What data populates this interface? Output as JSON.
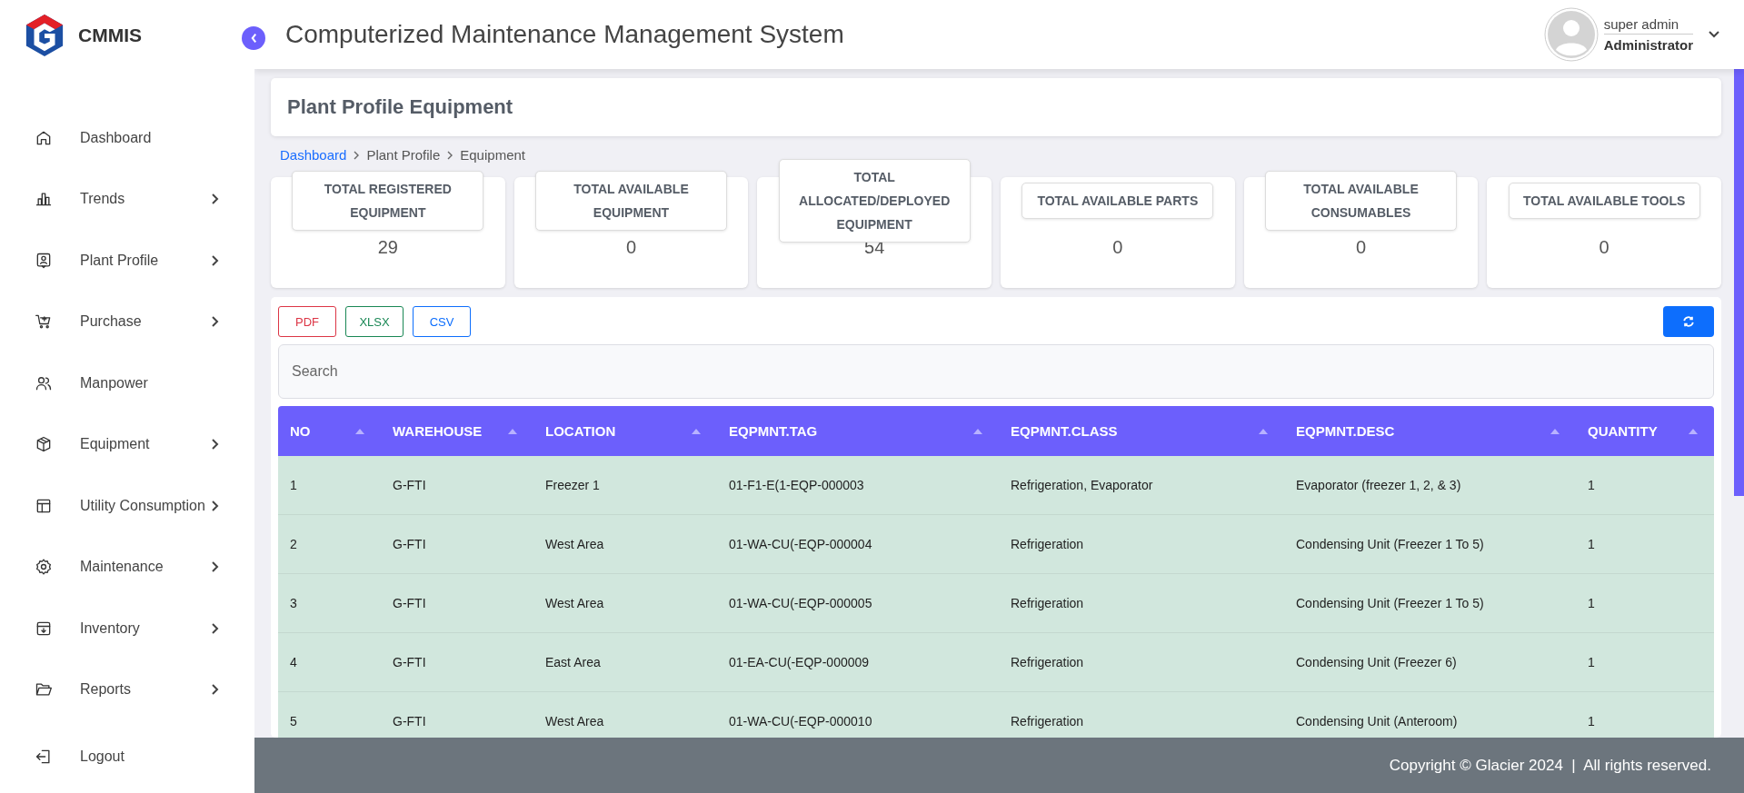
{
  "sidebar": {
    "brand": "CMMIS",
    "items": [
      {
        "label": "Dashboard",
        "expandable": false
      },
      {
        "label": "Trends",
        "expandable": true
      },
      {
        "label": "Plant Profile",
        "expandable": true
      },
      {
        "label": "Purchase",
        "expandable": true
      },
      {
        "label": "Manpower",
        "expandable": false
      },
      {
        "label": "Equipment",
        "expandable": true
      },
      {
        "label": "Utility Consumption",
        "expandable": true
      },
      {
        "label": "Maintenance",
        "expandable": true
      },
      {
        "label": "Inventory",
        "expandable": true
      },
      {
        "label": "Reports",
        "expandable": true
      }
    ],
    "logout": "Logout"
  },
  "header": {
    "title": "Computerized Maintenance Management System",
    "user_name": "super admin",
    "user_role": "Administrator"
  },
  "page_title": "Plant Profile Equipment",
  "breadcrumb": [
    {
      "label": "Dashboard",
      "kind": "link"
    },
    {
      "label": "Plant Profile",
      "kind": "text"
    },
    {
      "label": "Equipment",
      "kind": "text"
    }
  ],
  "stats": [
    {
      "label": "TOTAL REGISTERED EQUIPMENT",
      "value": "29"
    },
    {
      "label": "TOTAL AVAILABLE EQUIPMENT",
      "value": "0"
    },
    {
      "label": "TOTAL ALLOCATED/DEPLOYED EQUIPMENT",
      "value": "54"
    },
    {
      "label": "TOTAL AVAILABLE PARTS",
      "value": "0"
    },
    {
      "label": "TOTAL AVAILABLE CONSUMABLES",
      "value": "0"
    },
    {
      "label": "TOTAL AVAILABLE TOOLS",
      "value": "0"
    }
  ],
  "export_buttons": [
    {
      "label": "PDF",
      "kind": "pdf"
    },
    {
      "label": "XLSX",
      "kind": "xlsx"
    },
    {
      "label": "CSV",
      "kind": "csv"
    }
  ],
  "search": {
    "placeholder": "Search"
  },
  "table": {
    "columns": [
      "NO",
      "WAREHOUSE",
      "LOCATION",
      "EQPMNT.TAG",
      "EQPMNT.CLASS",
      "EQPMNT.DESC",
      "QUANTITY"
    ],
    "rows": [
      [
        "1",
        "G-FTI",
        "Freezer 1",
        "01-F1-E(1-EQP-000003",
        "Refrigeration, Evaporator",
        "Evaporator (freezer 1, 2, & 3)",
        "1"
      ],
      [
        "2",
        "G-FTI",
        "West Area",
        "01-WA-CU(-EQP-000004",
        "Refrigeration",
        "Condensing Unit (Freezer 1 To 5)",
        "1"
      ],
      [
        "3",
        "G-FTI",
        "West Area",
        "01-WA-CU(-EQP-000005",
        "Refrigeration",
        "Condensing Unit (Freezer 1 To 5)",
        "1"
      ],
      [
        "4",
        "G-FTI",
        "East Area",
        "01-EA-CU(-EQP-000009",
        "Refrigeration",
        "Condensing Unit (Freezer 6)",
        "1"
      ],
      [
        "5",
        "G-FTI",
        "West Area",
        "01-WA-CU(-EQP-000010",
        "Refrigeration",
        "Condensing Unit (Anteroom)",
        "1"
      ]
    ]
  },
  "footer": "Copyright © Glacier 2024  |  All rights reserved."
}
